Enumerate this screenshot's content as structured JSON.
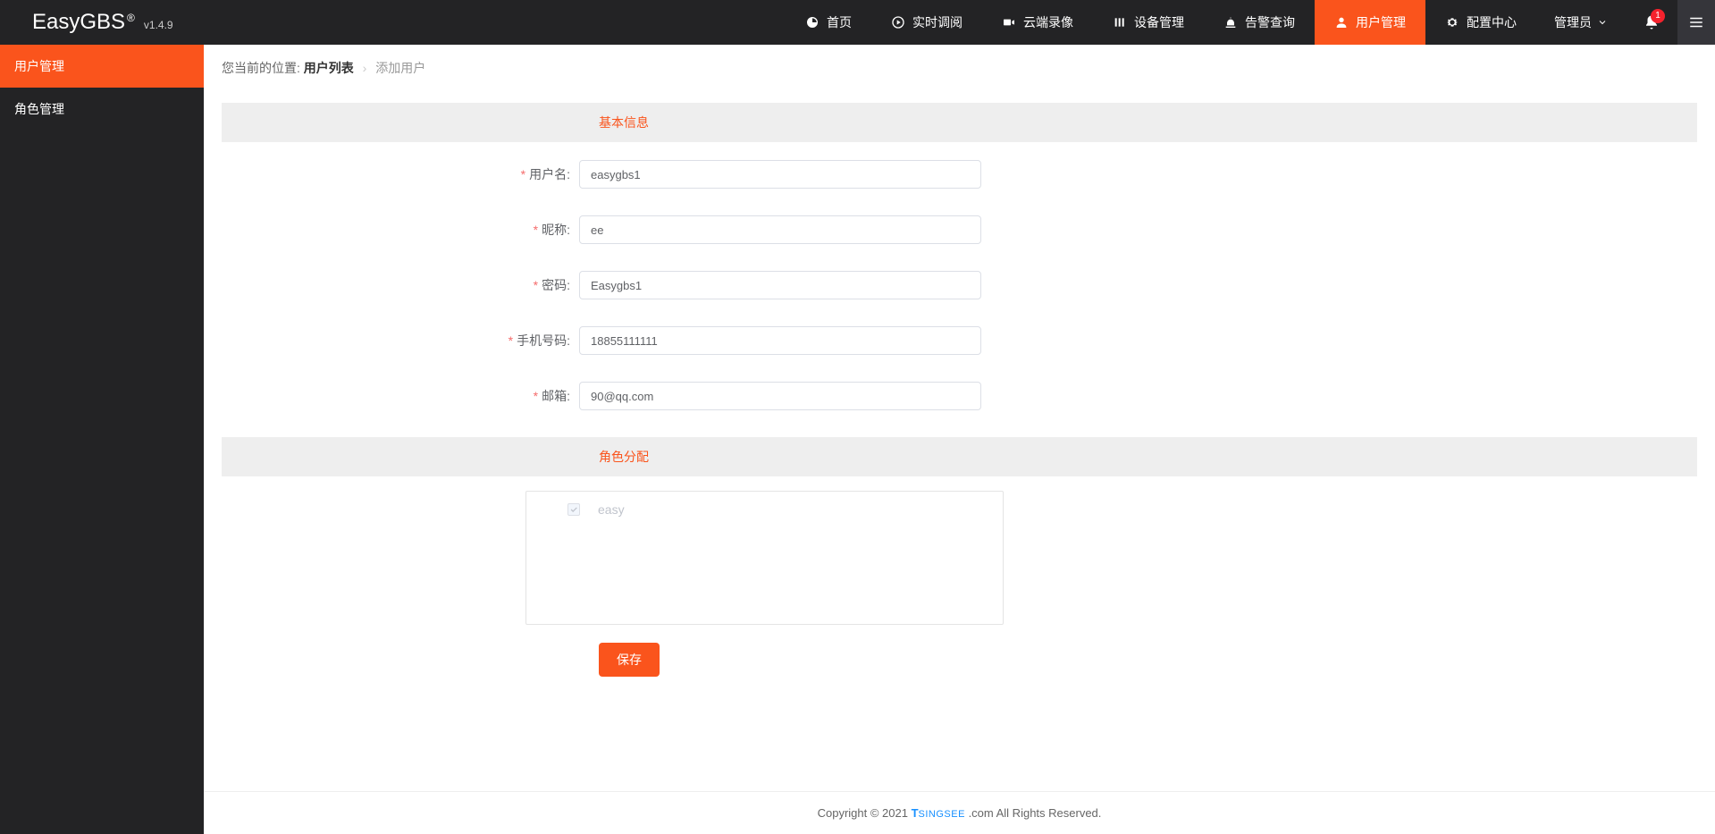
{
  "brand": {
    "name": "EasyGBS",
    "reg": "®",
    "version": "v1.4.9"
  },
  "nav": [
    {
      "label": "首页",
      "icon": "dashboard-icon"
    },
    {
      "label": "实时调阅",
      "icon": "play-icon"
    },
    {
      "label": "云端录像",
      "icon": "video-icon"
    },
    {
      "label": "设备管理",
      "icon": "bars-icon"
    },
    {
      "label": "告警查询",
      "icon": "alert-icon"
    },
    {
      "label": "用户管理",
      "icon": "user-icon",
      "active": true
    },
    {
      "label": "配置中心",
      "icon": "gear-icon"
    }
  ],
  "header": {
    "admin": "管理员",
    "notification_count": "1"
  },
  "sidebar": {
    "items": [
      {
        "label": "用户管理",
        "active": true
      },
      {
        "label": "角色管理"
      }
    ]
  },
  "breadcrumb": {
    "prefix": "您当前的位置:",
    "link": "用户列表",
    "current": "添加用户"
  },
  "sections": {
    "basic": "基本信息",
    "role": "角色分配"
  },
  "form": {
    "username": {
      "label": "用户名:",
      "value": "easygbs1"
    },
    "nickname": {
      "label": "昵称:",
      "value": "ee"
    },
    "password": {
      "label": "密码:",
      "value": "Easygbs1"
    },
    "phone": {
      "label": "手机号码:",
      "value": "18855111111"
    },
    "email": {
      "label": "邮箱:",
      "value": "90@qq.com"
    }
  },
  "roles": [
    {
      "label": "easy",
      "checked": true,
      "disabled": true
    }
  ],
  "buttons": {
    "save": "保存"
  },
  "footer": {
    "copyright": "Copyright © 2021 ",
    "brand_t": "T",
    "brand_rest": "SINGSEE",
    "suffix": " .com All Rights Reserved."
  }
}
